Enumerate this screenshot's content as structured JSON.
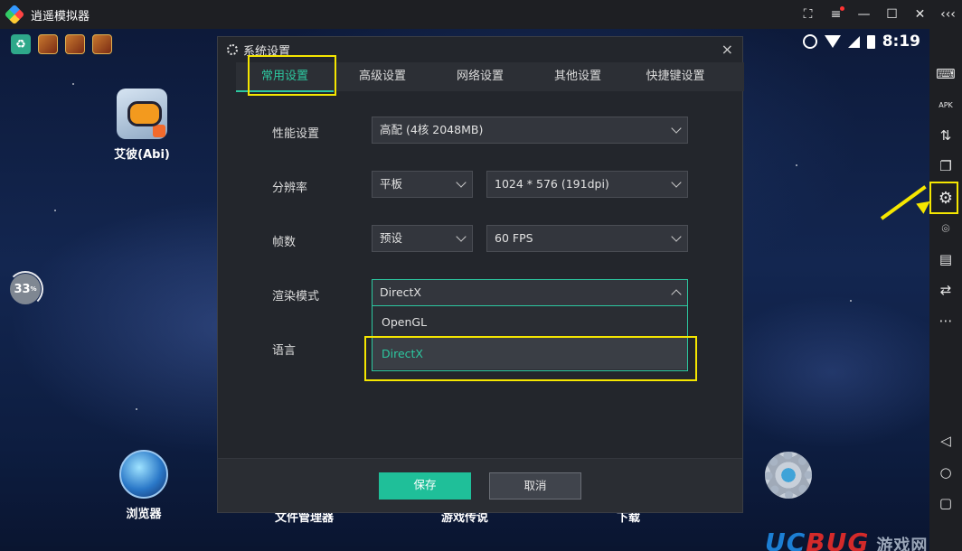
{
  "window": {
    "title": "逍遥模拟器"
  },
  "titlebar": {
    "buttons": [
      "⛶",
      "≡",
      "—",
      "☐",
      "✕",
      "‹‹‹"
    ]
  },
  "status": {
    "time": "8:19"
  },
  "desktop": {
    "apps": [
      {
        "label": "艾彼(Abi)"
      },
      {
        "label": "浏览器"
      }
    ],
    "bottom_labels": [
      "文件管理器",
      "游戏传说",
      "下载"
    ],
    "progress": "33",
    "progress_unit": "%",
    "watermark": {
      "left": "UC",
      "right": "BUG",
      "cn": "游戏网"
    }
  },
  "right_toolbar": [
    "⌨",
    "APK",
    "⇅",
    "❐",
    "⚙",
    "⌾",
    "▤",
    "⇄",
    "⋯",
    "◁",
    "○",
    "▢"
  ],
  "dialog": {
    "title": "系统设置",
    "close": "×",
    "tabs": [
      "常用设置",
      "高级设置",
      "网络设置",
      "其他设置",
      "快捷键设置"
    ],
    "active_tab": 0,
    "rows": {
      "performance": {
        "label": "性能设置",
        "value": "高配 (4核 2048MB)"
      },
      "resolution": {
        "label": "分辨率",
        "mode": "平板",
        "value": "1024 * 576 (191dpi)"
      },
      "fps": {
        "label": "帧数",
        "mode": "预设",
        "value": "60 FPS"
      },
      "render": {
        "label": "渲染模式",
        "value": "DirectX",
        "options": [
          "OpenGL",
          "DirectX"
        ],
        "selected": "DirectX"
      },
      "language": {
        "label": "语言"
      }
    },
    "save_label": "保存",
    "cancel_label": "取消"
  },
  "colors": {
    "accent": "#2cc8a0",
    "highlight": "#f5e600",
    "dialog_bg": "#23262c"
  }
}
